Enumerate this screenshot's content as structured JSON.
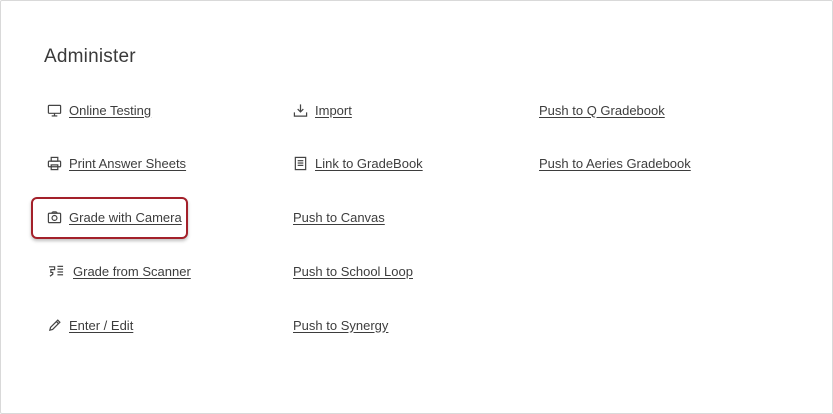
{
  "section": {
    "title": "Administer"
  },
  "columns": {
    "left": [
      {
        "label": "Online Testing",
        "icon": "monitor-icon"
      },
      {
        "label": "Print Answer Sheets",
        "icon": "printer-icon"
      },
      {
        "label": "Grade with Camera",
        "icon": "camera-icon"
      },
      {
        "label": "Grade from Scanner",
        "icon": "scanner-icon"
      },
      {
        "label": "Enter / Edit",
        "icon": "pencil-icon"
      }
    ],
    "middle": [
      {
        "label": "Import",
        "icon": "import-icon"
      },
      {
        "label": "Link to GradeBook",
        "icon": "book-icon"
      },
      {
        "label": "Push to Canvas"
      },
      {
        "label": "Push to School Loop"
      },
      {
        "label": "Push to Synergy"
      }
    ],
    "right": [
      {
        "label": "Push to Q Gradebook"
      },
      {
        "label": "Push to Aeries Gradebook"
      }
    ]
  },
  "highlight_color": "#a3202a"
}
